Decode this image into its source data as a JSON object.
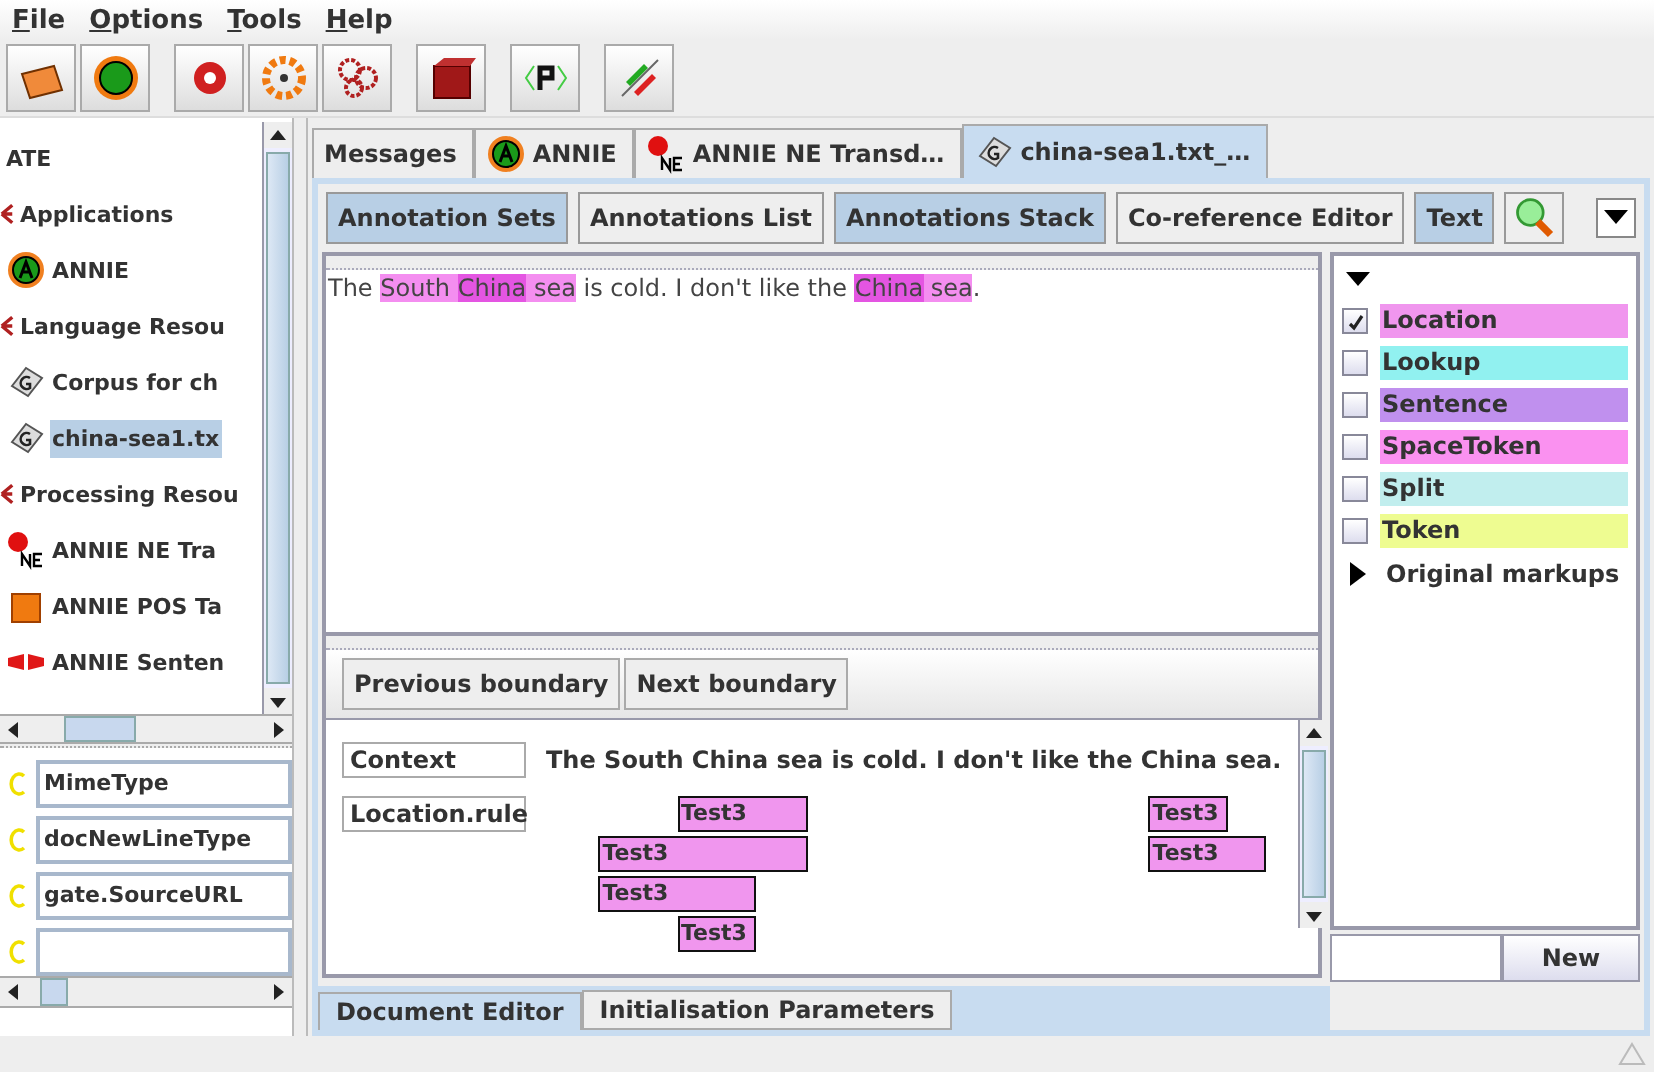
{
  "menu": [
    "File",
    "Options",
    "Tools",
    "Help"
  ],
  "resource_tree": {
    "label": "ATE",
    "children": [
      {
        "label": "Applications",
        "kind": "category",
        "selected": false,
        "children": [
          {
            "label": "ANNIE",
            "kind": "application",
            "selected": false
          }
        ]
      },
      {
        "label": "Language Resou",
        "kind": "category",
        "selected": false,
        "children": [
          {
            "label": "Corpus for ch",
            "kind": "document",
            "selected": false
          },
          {
            "label": "china-sea1.tx",
            "kind": "document",
            "selected": true
          }
        ]
      },
      {
        "label": "Processing Resou",
        "kind": "category",
        "selected": false,
        "children": [
          {
            "label": "ANNIE NE Tra",
            "kind": "ne",
            "selected": false
          },
          {
            "label": "ANNIE POS Ta",
            "kind": "pos",
            "selected": false
          },
          {
            "label": "ANNIE Senten",
            "kind": "splitter",
            "selected": false
          }
        ]
      }
    ]
  },
  "features": [
    "MimeType",
    "docNewLineType",
    "gate.SourceURL"
  ],
  "tabs": [
    {
      "label": "Messages",
      "kind": "plain",
      "selected": false
    },
    {
      "label": "ANNIE",
      "kind": "application",
      "selected": false
    },
    {
      "label": "ANNIE NE Transd…",
      "kind": "ne",
      "selected": false
    },
    {
      "label": "china-sea1.txt_…",
      "kind": "document",
      "selected": true
    }
  ],
  "view_buttons": [
    {
      "label": "Annotation Sets",
      "selected": true
    },
    {
      "label": "Annotations List",
      "selected": false
    },
    {
      "label": "Annotations Stack",
      "selected": true
    },
    {
      "label": "Co-reference Editor",
      "selected": false
    },
    {
      "label": "Text",
      "selected": true
    }
  ],
  "document_text": [
    {
      "text": "The "
    },
    {
      "text": "South ",
      "color": "#f48ef0"
    },
    {
      "text": "China",
      "color": "#e455e2"
    },
    {
      "text": " sea",
      "color": "#f48ef0"
    },
    {
      "text": " is cold. I don't like the "
    },
    {
      "text": "China",
      "color": "#e455e2"
    },
    {
      "text": " sea",
      "color": "#f48ef0"
    },
    {
      "text": "."
    }
  ],
  "stack": {
    "buttons": [
      "Previous boundary",
      "Next boundary"
    ],
    "context_label": "Context",
    "context": "The South China sea is cold. I don't like the China sea.",
    "row_label": "Location.rule",
    "rows": [
      [
        "Test3",
        "Test3"
      ],
      [
        "Test3",
        "Test3"
      ],
      [
        "Test3"
      ],
      [
        "Test3"
      ]
    ]
  },
  "bottom_tabs": [
    {
      "label": "Document Editor",
      "selected": true
    },
    {
      "label": "Initialisation Parameters",
      "selected": false
    }
  ],
  "annotation_sets": {
    "expanded": true,
    "types": [
      {
        "label": "Location",
        "checked": true,
        "color": "#f096ee"
      },
      {
        "label": "Lookup",
        "checked": false,
        "color": "#91f1f0"
      },
      {
        "label": "Sentence",
        "checked": false,
        "color": "#c090ee"
      },
      {
        "label": "SpaceToken",
        "checked": false,
        "color": "#fa91f0"
      },
      {
        "label": "Split",
        "checked": false,
        "color": "#c1eeee"
      },
      {
        "label": "Token",
        "checked": false,
        "color": "#eefc91"
      }
    ],
    "others": [
      {
        "label": "Original markups",
        "expanded": false
      }
    ],
    "new_button": "New"
  }
}
